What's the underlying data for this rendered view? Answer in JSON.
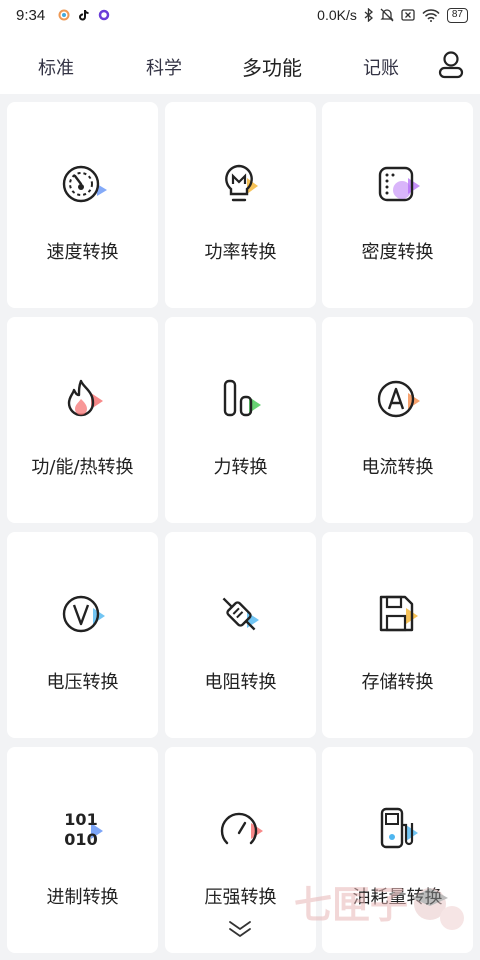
{
  "status_bar": {
    "time": "9:34",
    "speed": "0.0K/s",
    "battery": "87"
  },
  "tabs": [
    {
      "label": "标准"
    },
    {
      "label": "科学"
    },
    {
      "label": "多功能"
    },
    {
      "label": "记账"
    }
  ],
  "active_tab": "多功能",
  "cards": [
    {
      "label": "速度转换",
      "icon": "speedometer-icon",
      "accent": "#5b8ef5"
    },
    {
      "label": "功率转换",
      "icon": "bulb-icon",
      "accent": "#f5b73b"
    },
    {
      "label": "密度转换",
      "icon": "density-icon",
      "accent": "#b36cf5"
    },
    {
      "label": "功/能/热转换",
      "icon": "flame-icon",
      "accent": "#f56b6b"
    },
    {
      "label": "力转换",
      "icon": "force-icon",
      "accent": "#4cc95a"
    },
    {
      "label": "电流转换",
      "icon": "ampere-icon",
      "accent": "#f58c4b"
    },
    {
      "label": "电压转换",
      "icon": "voltage-icon",
      "accent": "#4fb6f0"
    },
    {
      "label": "电阻转换",
      "icon": "resistor-icon",
      "accent": "#4fb6f0"
    },
    {
      "label": "存储转换",
      "icon": "floppy-icon",
      "accent": "#f5b73b"
    },
    {
      "label": "进制转换",
      "icon": "binary-icon",
      "accent": "#5b8ef5"
    },
    {
      "label": "压强转换",
      "icon": "gauge-icon",
      "accent": "#f56b6b"
    },
    {
      "label": "油耗量转换",
      "icon": "fuel-icon",
      "accent": "#4fb6f0"
    }
  ],
  "binary_text": {
    "line1": "101",
    "line2": "010"
  },
  "watermark_text": "七匣子"
}
